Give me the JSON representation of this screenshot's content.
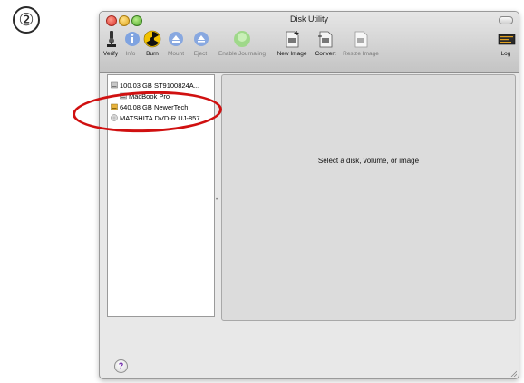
{
  "step_marker": "②",
  "window": {
    "title": "Disk Utility"
  },
  "toolbar": [
    {
      "label": "Verify",
      "icon": "microscope-icon",
      "enabled": true
    },
    {
      "label": "Info",
      "icon": "info-icon",
      "enabled": false
    },
    {
      "label": "Burn",
      "icon": "burn-icon",
      "enabled": true
    },
    {
      "label": "Mount",
      "icon": "mount-icon",
      "enabled": false
    },
    {
      "label": "Eject",
      "icon": "eject-icon",
      "enabled": false
    },
    {
      "label": "Enable Journaling",
      "icon": "journaling-icon",
      "enabled": false
    },
    {
      "label": "New Image",
      "icon": "new-image-icon",
      "enabled": true
    },
    {
      "label": "Convert",
      "icon": "convert-icon",
      "enabled": true
    },
    {
      "label": "Resize Image",
      "icon": "resize-image-icon",
      "enabled": false
    },
    {
      "label": "Log",
      "icon": "log-icon",
      "enabled": true
    }
  ],
  "sidebar": {
    "items": [
      {
        "label": "100.03 GB ST9100824A...",
        "icon": "hard-disk-icon",
        "level": 0
      },
      {
        "label": "MacBook Pro",
        "icon": "volume-icon",
        "level": 1
      },
      {
        "label": "640.08 GB NewerTech",
        "icon": "external-disk-icon",
        "level": 0
      },
      {
        "label": "MATSHITA DVD-R UJ-857",
        "icon": "optical-drive-icon",
        "level": 0
      }
    ]
  },
  "main": {
    "placeholder": "Select a disk, volume, or image"
  },
  "help": {
    "label": "?"
  },
  "colors": {
    "highlight": "#d01010",
    "window_bg": "#e8e8e8",
    "pane_bg": "#dcdcdc"
  }
}
